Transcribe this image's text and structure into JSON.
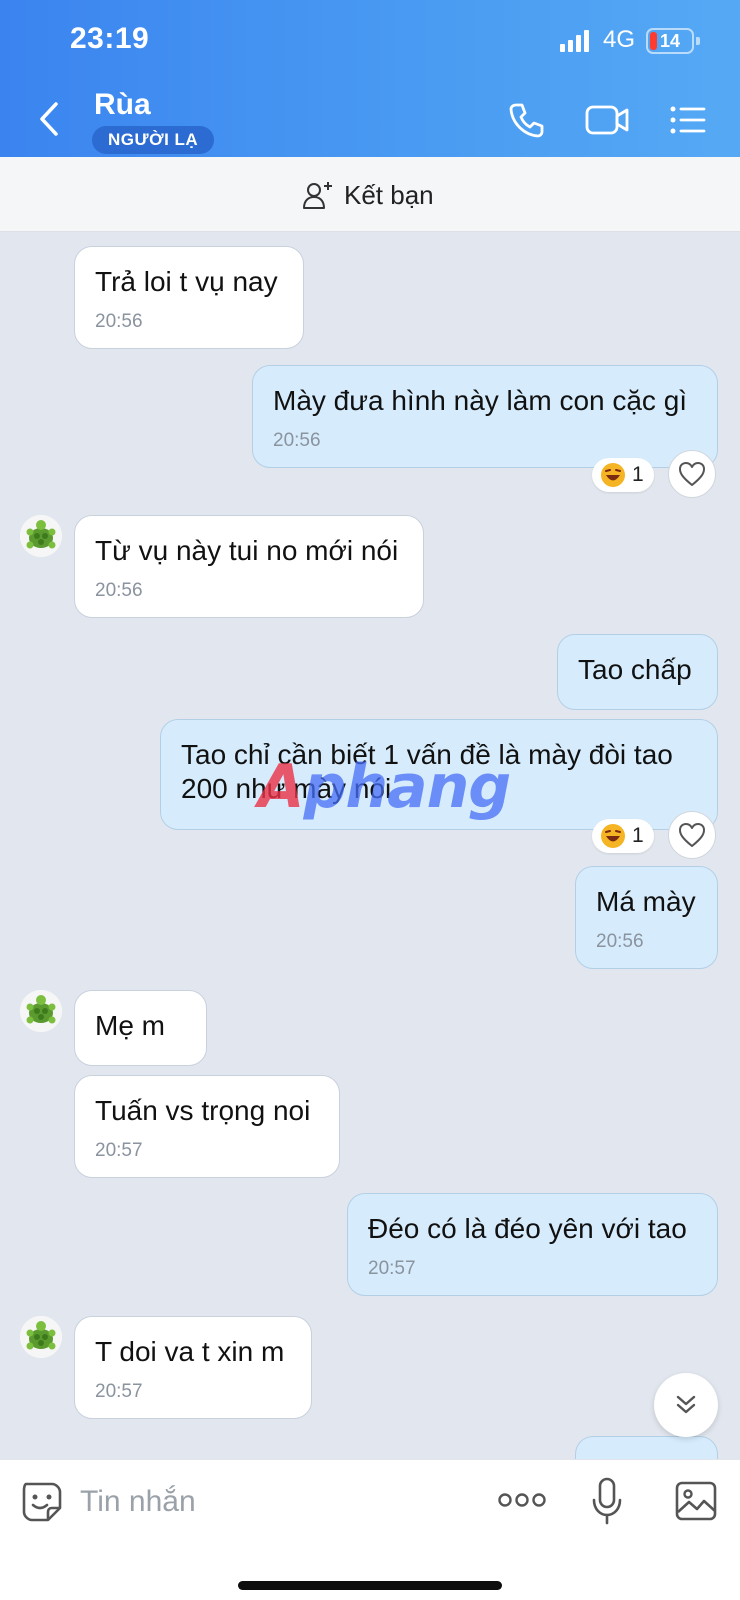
{
  "status_bar": {
    "time": "23:19",
    "network": "4G",
    "battery": "14"
  },
  "header": {
    "name": "Rùa",
    "badge": "NGƯỜI LẠ"
  },
  "add_friend": {
    "label": "Kết bạn"
  },
  "messages": [
    {
      "text": "Trả loi t vụ nay",
      "time": "20:56"
    },
    {
      "text": "Mày đưa hình này làm con cặc gì",
      "time": "20:56",
      "reaction_count": "1"
    },
    {
      "text": "Từ vụ này tui no mới nói",
      "time": "20:56"
    },
    {
      "text": "Tao chấp"
    },
    {
      "text": "Tao chỉ cần biết 1 vấn đề là mày đòi tao 200 như mày nói",
      "reaction_count": "1"
    },
    {
      "text": "Má mày",
      "time": "20:56"
    },
    {
      "text": "Mẹ m"
    },
    {
      "text": "Tuấn vs trọng noi",
      "time": "20:57"
    },
    {
      "text": "Đéo có là đéo yên với tao",
      "time": "20:57"
    },
    {
      "text": "T doi va t xin m",
      "time": "20:57"
    }
  ],
  "watermark": {
    "first": "A",
    "rest": "phang"
  },
  "input": {
    "placeholder": "Tin nhắn"
  },
  "icons": {
    "back": "chevron-left-icon",
    "call": "phone-icon",
    "video": "video-camera-icon",
    "menu": "list-menu-icon",
    "add_friend": "add-user-icon",
    "avatar": "turtle-icon",
    "reaction": "laughing-emoji-icon",
    "heart": "heart-icon",
    "scroll": "chevron-double-down-icon",
    "emoji": "sticker-icon",
    "more": "more-dots-icon",
    "mic": "microphone-icon",
    "image": "image-icon"
  }
}
